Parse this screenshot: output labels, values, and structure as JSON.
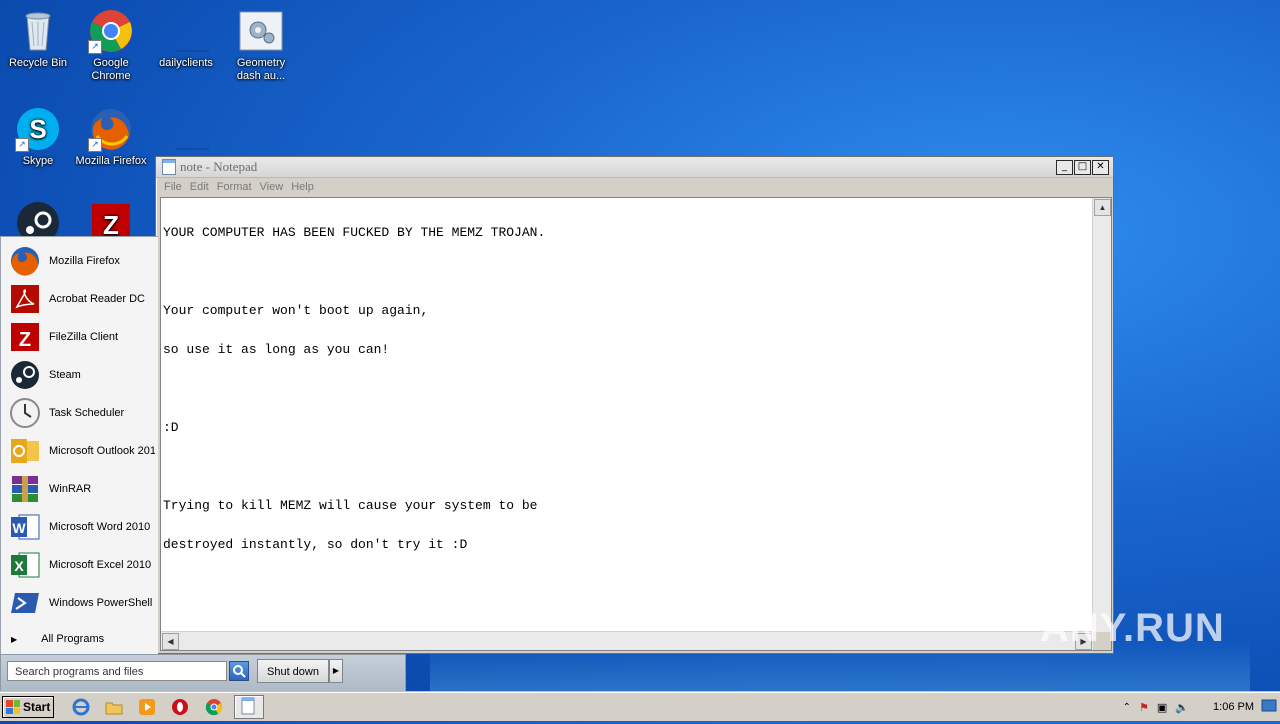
{
  "desktop": {
    "icons": [
      {
        "label": "Recycle Bin",
        "icon": "recycle-bin-icon"
      },
      {
        "label": "Google Chrome",
        "icon": "chrome-icon"
      },
      {
        "label": "dailyclients",
        "icon": "folder-icon"
      },
      {
        "label": "Geometry dash au...",
        "icon": "settings-file-icon"
      },
      {
        "label": "Skype",
        "icon": "skype-icon"
      },
      {
        "label": "Mozilla Firefox",
        "icon": "firefox-icon"
      }
    ]
  },
  "notepad": {
    "title": "note - Notepad",
    "menu": [
      "File",
      "Edit",
      "Format",
      "View",
      "Help"
    ],
    "lines": [
      "YOUR COMPUTER HAS BEEN FUCKED BY THE MEMZ TROJAN.",
      "",
      "Your computer won't boot up again,",
      "so use it as long as you can!",
      "",
      ":D",
      "",
      "Trying to kill MEMZ will cause your system to be",
      "destroyed instantly, so don't try it :D"
    ]
  },
  "start_menu": {
    "items": [
      {
        "label": "Mozilla Firefox",
        "icon": "firefox-icon"
      },
      {
        "label": "Acrobat Reader DC",
        "icon": "acrobat-icon"
      },
      {
        "label": "FileZilla Client",
        "icon": "filezilla-icon"
      },
      {
        "label": "Steam",
        "icon": "steam-icon"
      },
      {
        "label": "Task Scheduler",
        "icon": "clock-icon"
      },
      {
        "label": "Microsoft Outlook 201",
        "icon": "outlook-icon"
      },
      {
        "label": "WinRAR",
        "icon": "winrar-icon"
      },
      {
        "label": "Microsoft Word 2010",
        "icon": "word-icon"
      },
      {
        "label": "Microsoft Excel 2010",
        "icon": "excel-icon"
      },
      {
        "label": "Windows PowerShell",
        "icon": "powershell-icon"
      }
    ],
    "all_programs": "All Programs",
    "search_placeholder": "Search programs and files",
    "shutdown_label": "Shut down"
  },
  "taskbar": {
    "start_label": "Start",
    "clock": "1:06 PM",
    "pinned": [
      "ie-icon",
      "explorer-icon",
      "media-player-icon",
      "opera-icon",
      "chrome-icon",
      "notepad-icon"
    ]
  },
  "watermark": "ANY.RUN",
  "colors": {
    "desktop_blue": "#1a67cf",
    "window_frame": "#d4d0c8",
    "start_panel": "#f4f4f4"
  }
}
